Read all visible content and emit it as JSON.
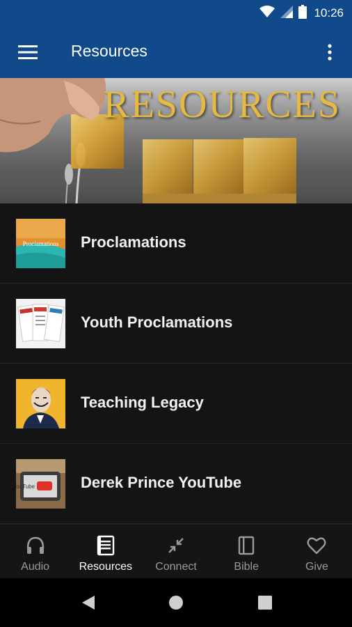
{
  "status_bar": {
    "time": "10:26",
    "icons": [
      "wifi-icon",
      "signal-icon",
      "battery-icon"
    ]
  },
  "app_bar": {
    "title": "Resources",
    "menu_icon": "hamburger-menu-icon",
    "overflow_icon": "more-vert-icon"
  },
  "banner": {
    "title": "RESOURCES"
  },
  "resources": [
    {
      "label": "Proclamations",
      "thumb_icon": "proclamations-thumb"
    },
    {
      "label": "Youth Proclamations",
      "thumb_icon": "youth-proclamations-thumb"
    },
    {
      "label": "Teaching Legacy",
      "thumb_icon": "teaching-legacy-thumb"
    },
    {
      "label": "Derek Prince YouTube",
      "thumb_icon": "youtube-thumb"
    }
  ],
  "thumb_text": {
    "proclamations": "Proclamations",
    "youtube": "YouTube"
  },
  "bottom_nav": [
    {
      "label": "Audio",
      "icon": "headphones-icon",
      "active": false
    },
    {
      "label": "Resources",
      "icon": "book-icon",
      "active": true
    },
    {
      "label": "Connect",
      "icon": "connect-arrows-icon",
      "active": false
    },
    {
      "label": "Bible",
      "icon": "bible-icon",
      "active": false
    },
    {
      "label": "Give",
      "icon": "heart-icon",
      "active": false
    }
  ],
  "colors": {
    "app_bar": "#104a8a",
    "background": "#141414",
    "banner_text": "#e6b940",
    "inactive_nav": "#9a9a9a"
  }
}
